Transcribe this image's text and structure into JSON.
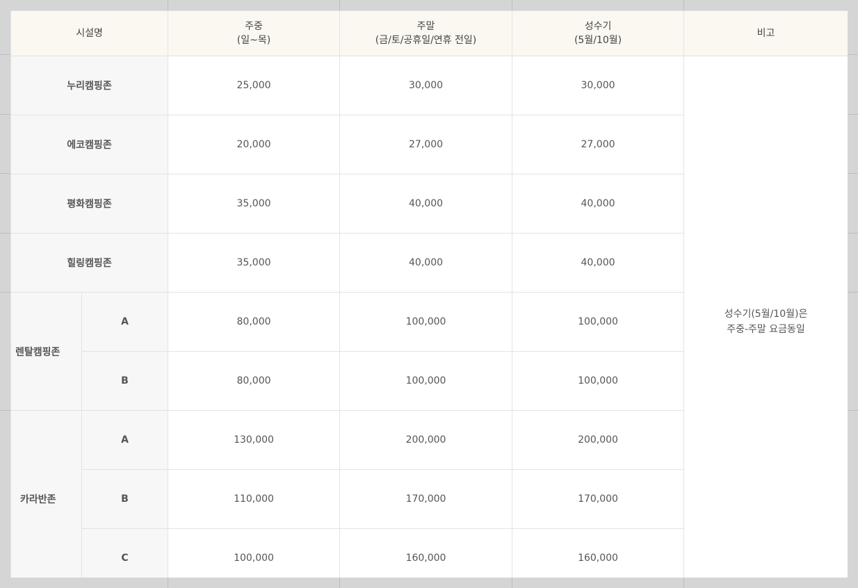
{
  "table": {
    "headers": {
      "facility": "시설명",
      "weekday": [
        "주중",
        "(일~목)"
      ],
      "weekend": [
        "주말",
        "(금/토/공휴일/연휴 전일)"
      ],
      "peak": [
        "성수기",
        "(5월/10월)"
      ],
      "note": "비고"
    },
    "rows": [
      {
        "name": "누리캠핑존",
        "weekday": "25,000",
        "weekend": "30,000",
        "peak": "30,000"
      },
      {
        "name": "에코캠핑존",
        "weekday": "20,000",
        "weekend": "27,000",
        "peak": "27,000"
      },
      {
        "name": "평화캠핑존",
        "weekday": "35,000",
        "weekend": "40,000",
        "peak": "40,000"
      },
      {
        "name": "힐링캠핑존",
        "weekday": "35,000",
        "weekend": "40,000",
        "peak": "40,000"
      }
    ],
    "rental": {
      "name": "렌탈캠핑존",
      "items": [
        {
          "sub": "A",
          "weekday": "80,000",
          "weekend": "100,000",
          "peak": "100,000"
        },
        {
          "sub": "B",
          "weekday": "80,000",
          "weekend": "100,000",
          "peak": "100,000"
        }
      ]
    },
    "caravan": {
      "name": "카라반존",
      "items": [
        {
          "sub": "A",
          "weekday": "130,000",
          "weekend": "200,000",
          "peak": "200,000"
        },
        {
          "sub": "B",
          "weekday": "110,000",
          "weekend": "170,000",
          "peak": "170,000"
        },
        {
          "sub": "C",
          "weekday": "100,000",
          "weekend": "160,000",
          "peak": "160,000"
        }
      ]
    },
    "note": [
      "성수기(5월/10월)은",
      "주중-주말 요금동일"
    ]
  }
}
